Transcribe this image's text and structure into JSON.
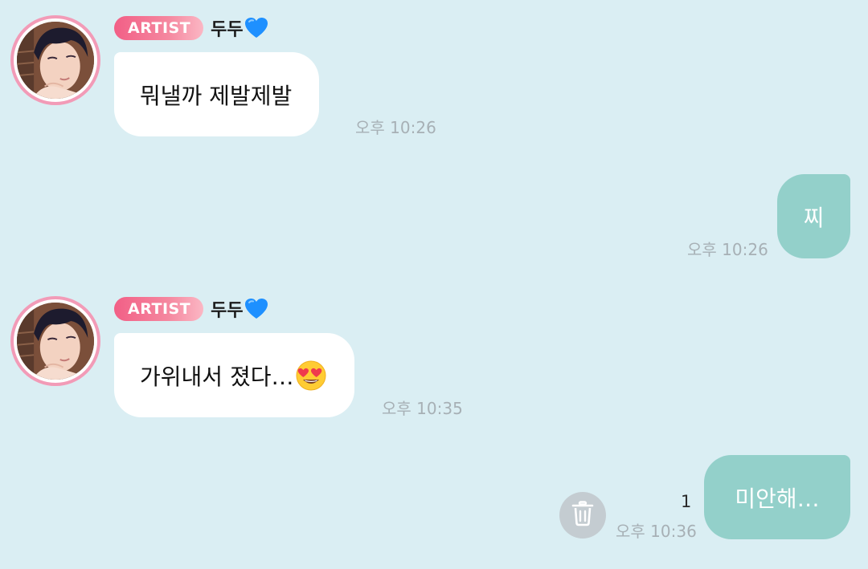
{
  "messages": [
    {
      "direction": "incoming",
      "badge": "ARTIST",
      "sender": "두두",
      "heart_icon": "blue-heart-icon",
      "text": "뭐낼까 제발제발",
      "time": "오후 10:26"
    },
    {
      "direction": "outgoing",
      "text": "찌",
      "time": "오후 10:26"
    },
    {
      "direction": "incoming",
      "badge": "ARTIST",
      "sender": "두두",
      "heart_icon": "blue-heart-icon",
      "text": "가위내서 졌다…",
      "emoji": "heart-eyes-emoji-icon",
      "time": "오후 10:35"
    },
    {
      "direction": "outgoing",
      "text": "미안해…",
      "time": "오후 10:36",
      "unread_count": "1",
      "action_icon": "trash-icon"
    }
  ],
  "colors": {
    "background": "#daeef3",
    "incoming_bubble": "#ffffff",
    "outgoing_bubble": "#93d0ca",
    "badge": "#f25f86",
    "avatar_ring": "#f29bb7",
    "timestamp": "#a7b0b5",
    "heart": "#1e90ff"
  }
}
